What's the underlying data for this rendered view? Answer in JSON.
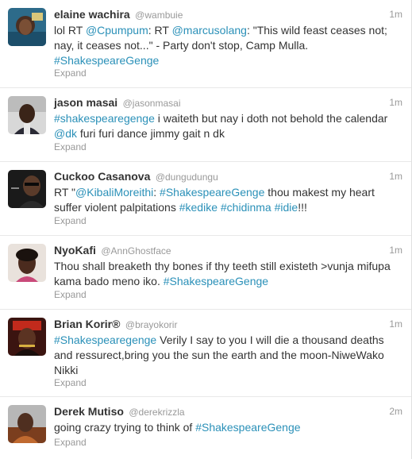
{
  "tweets": [
    {
      "fullname": "elaine wachira",
      "username": "@wambuie",
      "time": "1m",
      "segments": [
        {
          "t": "lol RT ",
          "l": false
        },
        {
          "t": "@Cpumpum",
          "l": true
        },
        {
          "t": ": RT ",
          "l": false
        },
        {
          "t": "@marcusolang",
          "l": true
        },
        {
          "t": ": \"This wild feast ceases not; nay, it ceases not...\" - Party don't stop, Camp Mulla. ",
          "l": false
        },
        {
          "t": "#ShakespeareGenge",
          "l": true
        }
      ],
      "expand": "Expand"
    },
    {
      "fullname": "jason masai",
      "username": "@jasonmasai",
      "time": "1m",
      "segments": [
        {
          "t": "#shakespearegenge",
          "l": true
        },
        {
          "t": " i waiteth but nay i doth not behold the calendar ",
          "l": false
        },
        {
          "t": "@dk",
          "l": true
        },
        {
          "t": " furi furi dance jimmy gait n dk",
          "l": false
        }
      ],
      "expand": "Expand"
    },
    {
      "fullname": "Cuckoo Casanova",
      "username": "@dungudungu",
      "time": "1m",
      "segments": [
        {
          "t": "RT \"",
          "l": false
        },
        {
          "t": "@KibaliMoreithi",
          "l": true
        },
        {
          "t": ": ",
          "l": false
        },
        {
          "t": "#ShakespeareGenge",
          "l": true
        },
        {
          "t": " thou makest my heart suffer violent palpitations ",
          "l": false
        },
        {
          "t": "#kedike",
          "l": true
        },
        {
          "t": " ",
          "l": false
        },
        {
          "t": "#chidinma",
          "l": true
        },
        {
          "t": " ",
          "l": false
        },
        {
          "t": "#idie",
          "l": true
        },
        {
          "t": "!!!",
          "l": false
        }
      ],
      "expand": "Expand"
    },
    {
      "fullname": "NyoKafi",
      "username": "@AnnGhostface",
      "time": "1m",
      "segments": [
        {
          "t": "Thou shall breaketh thy bones if thy teeth still existeth >vunja mifupa kama bado meno iko. ",
          "l": false
        },
        {
          "t": "#ShakespeareGenge",
          "l": true
        }
      ],
      "expand": "Expand"
    },
    {
      "fullname": "Brian Korir®",
      "username": "@brayokorir",
      "time": "1m",
      "segments": [
        {
          "t": "#Shakespearegenge",
          "l": true
        },
        {
          "t": " Verily I say to you I will die a thousand deaths and ressurect,bring you the sun the earth and the moon-NiweWako Nikki",
          "l": false
        }
      ],
      "expand": "Expand"
    },
    {
      "fullname": "Derek Mutiso",
      "username": "@derekrizzla",
      "time": "2m",
      "segments": [
        {
          "t": "going crazy trying to think of ",
          "l": false
        },
        {
          "t": "#ShakespeareGenge",
          "l": true
        }
      ],
      "expand": "Expand"
    }
  ]
}
